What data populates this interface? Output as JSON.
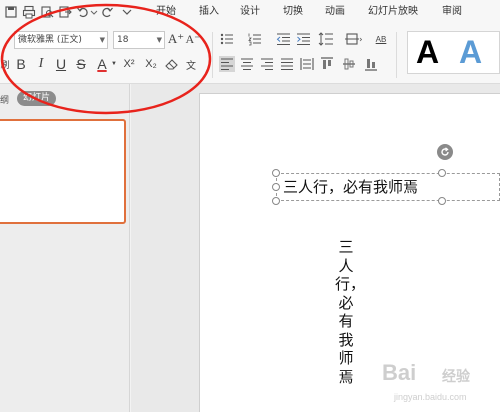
{
  "menubar": {
    "tabs": [
      "开始",
      "插入",
      "设计",
      "切换",
      "动画",
      "幻灯片放映",
      "审阅"
    ],
    "quick_access_icons": [
      "save-icon",
      "print-icon",
      "print-preview-icon",
      "export-icon",
      "undo-icon",
      "redo-icon",
      "dropdown-icon"
    ]
  },
  "ribbon": {
    "font_name": "微软雅黑 (正文)",
    "font_size": "18",
    "bold": "B",
    "italic": "I",
    "underline": "U",
    "strikethrough": "S",
    "font_color": "A",
    "superscript": "X²",
    "subscript": "X₂",
    "phonetic": "文",
    "grow_font": "A⁺",
    "shrink_font": "A⁻",
    "paragraph_label": "AB",
    "gallery_letter_1": "A",
    "gallery_letter_2": "A",
    "gallery_color_1": "#000000",
    "gallery_color_2": "#5b9bd5",
    "left_cut_label": "刷"
  },
  "left_panel": {
    "outline_tab": "纲",
    "slides_tab": "幻灯片"
  },
  "slide": {
    "horizontal_text": "三人行，必有我师焉",
    "vertical_text": "三人行，必有我师焉"
  },
  "annotation": {
    "ellipse_color": "#e8231c"
  },
  "watermark": {
    "text_1": "Bai",
    "text_2": "经验",
    "text_3": "jingyan.baidu.com"
  }
}
